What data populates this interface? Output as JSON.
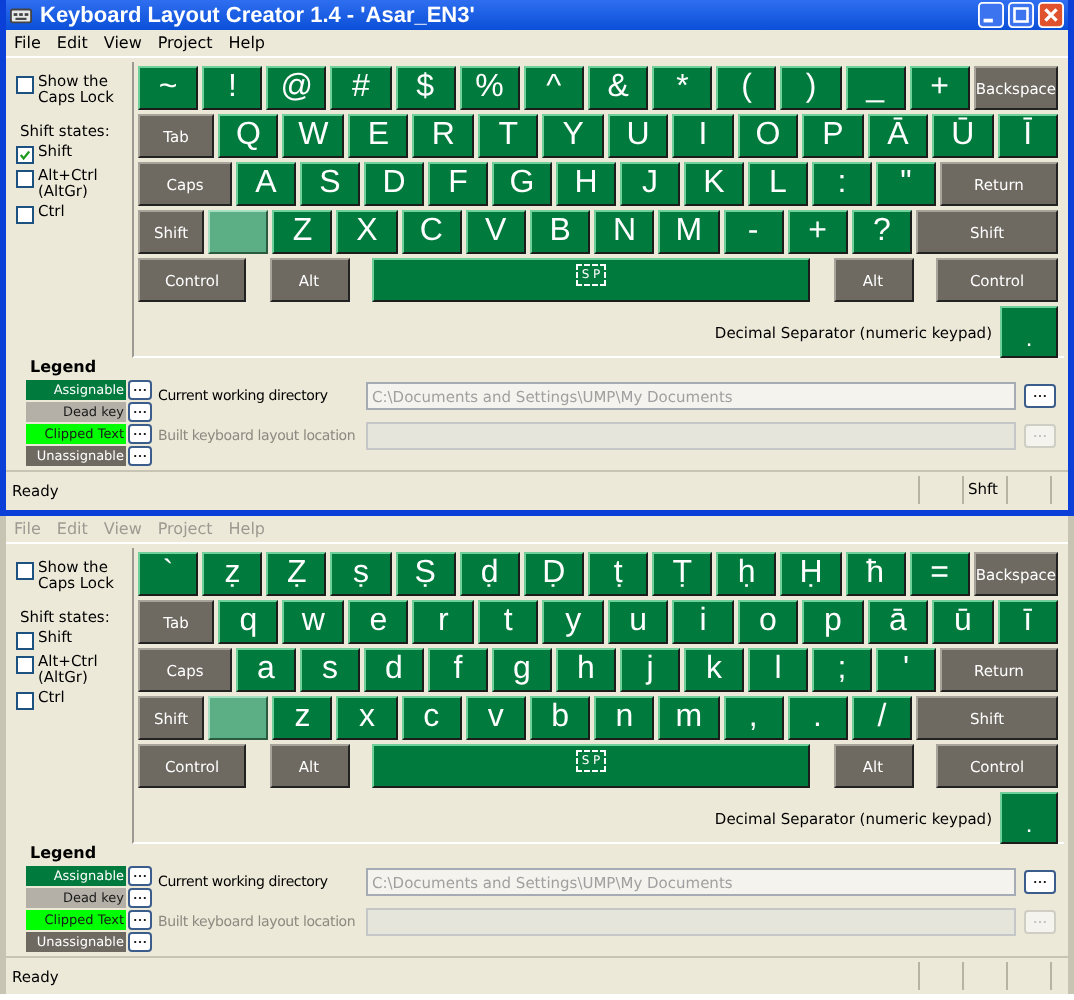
{
  "windows": [
    {
      "title": "Keyboard Layout Creator 1.4 - 'Asar_EN3'",
      "menu": [
        {
          "label": "File",
          "disabled": false
        },
        {
          "label": "Edit",
          "disabled": false
        },
        {
          "label": "View",
          "disabled": false
        },
        {
          "label": "Project",
          "disabled": false
        },
        {
          "label": "Help",
          "disabled": false
        }
      ],
      "caps_lock_option": {
        "label": "Show the Caps Lock",
        "checked": false
      },
      "shift_states": {
        "label": "Shift states:",
        "options": [
          {
            "label": "Shift",
            "checked": true
          },
          {
            "label": "Alt+Ctrl (AltGr)",
            "checked": false
          },
          {
            "label": "Ctrl",
            "checked": false
          }
        ]
      },
      "keyboard": {
        "rows": [
          [
            {
              "kind": "char",
              "label": "~"
            },
            {
              "kind": "char",
              "label": "!"
            },
            {
              "kind": "char",
              "label": "@"
            },
            {
              "kind": "char",
              "label": "#"
            },
            {
              "kind": "char",
              "label": "$"
            },
            {
              "kind": "char",
              "label": "%"
            },
            {
              "kind": "char",
              "label": "^"
            },
            {
              "kind": "char",
              "label": "&"
            },
            {
              "kind": "char",
              "label": "*"
            },
            {
              "kind": "char",
              "label": "("
            },
            {
              "kind": "char",
              "label": ")"
            },
            {
              "kind": "char",
              "label": "_"
            },
            {
              "kind": "char",
              "label": "+"
            },
            {
              "kind": "backspace",
              "label": "Backspace"
            }
          ],
          [
            {
              "kind": "tab",
              "label": "Tab"
            },
            {
              "kind": "char",
              "label": "Q"
            },
            {
              "kind": "char",
              "label": "W"
            },
            {
              "kind": "char",
              "label": "E"
            },
            {
              "kind": "char",
              "label": "R"
            },
            {
              "kind": "char",
              "label": "T"
            },
            {
              "kind": "char",
              "label": "Y"
            },
            {
              "kind": "char",
              "label": "U"
            },
            {
              "kind": "char",
              "label": "I"
            },
            {
              "kind": "char",
              "label": "O"
            },
            {
              "kind": "char",
              "label": "P"
            },
            {
              "kind": "char",
              "label": "Ā"
            },
            {
              "kind": "char",
              "label": "Ū"
            },
            {
              "kind": "char",
              "label": "Ī"
            }
          ],
          [
            {
              "kind": "caps",
              "label": "Caps"
            },
            {
              "kind": "char",
              "label": "A"
            },
            {
              "kind": "char",
              "label": "S"
            },
            {
              "kind": "char",
              "label": "D"
            },
            {
              "kind": "char",
              "label": "F"
            },
            {
              "kind": "char",
              "label": "G"
            },
            {
              "kind": "char",
              "label": "H"
            },
            {
              "kind": "char",
              "label": "J"
            },
            {
              "kind": "char",
              "label": "K"
            },
            {
              "kind": "char",
              "label": "L"
            },
            {
              "kind": "char",
              "label": ":"
            },
            {
              "kind": "char",
              "label": "\""
            },
            {
              "kind": "return",
              "label": "Return"
            }
          ],
          [
            {
              "kind": "shift_left",
              "label": "Shift"
            },
            {
              "kind": "blank"
            },
            {
              "kind": "char",
              "label": "Z"
            },
            {
              "kind": "char",
              "label": "X"
            },
            {
              "kind": "char",
              "label": "C"
            },
            {
              "kind": "char",
              "label": "V"
            },
            {
              "kind": "char",
              "label": "B"
            },
            {
              "kind": "char",
              "label": "N"
            },
            {
              "kind": "char",
              "label": "M"
            },
            {
              "kind": "char",
              "label": "-"
            },
            {
              "kind": "char",
              "label": "+"
            },
            {
              "kind": "char",
              "label": "?"
            },
            {
              "kind": "shift_right",
              "label": "Shift"
            }
          ],
          [
            {
              "kind": "control_left",
              "label": "Control"
            },
            {
              "kind": "alt",
              "label": "Alt"
            },
            {
              "kind": "space",
              "label": "S P"
            },
            {
              "kind": "alt",
              "label": "Alt"
            },
            {
              "kind": "control_right",
              "label": "Control"
            }
          ]
        ]
      },
      "decimal_separator": {
        "label": "Decimal Separator (numeric keypad)",
        "key": "."
      },
      "legend": {
        "title": "Legend",
        "items": [
          {
            "label": "Assignable",
            "color": "#007a3d"
          },
          {
            "label": "Dead key",
            "color": "#b4b0a8"
          },
          {
            "label": "Clipped Text",
            "color": "#00ff00"
          },
          {
            "label": "Unassignable",
            "color": "#6e6a62"
          }
        ]
      },
      "working_directory": {
        "label": "Current working directory",
        "value": "C:\\Documents and Settings\\UMP\\My Documents"
      },
      "build_location": {
        "label": "Built keyboard layout location",
        "disabled": true
      },
      "status_bar": {
        "text": "Ready",
        "indicators": [
          "Shft"
        ]
      }
    },
    {
      "menu": [
        {
          "label": "File",
          "disabled": true
        },
        {
          "label": "Edit",
          "disabled": true
        },
        {
          "label": "View",
          "disabled": true
        },
        {
          "label": "Project",
          "disabled": true
        },
        {
          "label": "Help",
          "disabled": true
        }
      ],
      "caps_lock_option": {
        "label": "Show the Caps Lock",
        "checked": false
      },
      "shift_states": {
        "label": "Shift states:",
        "options": [
          {
            "label": "Shift",
            "checked": false
          },
          {
            "label": "Alt+Ctrl (AltGr)",
            "checked": false
          },
          {
            "label": "Ctrl",
            "checked": false
          }
        ]
      },
      "keyboard": {
        "rows": [
          [
            {
              "kind": "char",
              "label": "`"
            },
            {
              "kind": "char",
              "label": "ẓ"
            },
            {
              "kind": "char",
              "label": "Ẓ"
            },
            {
              "kind": "char",
              "label": "ṣ"
            },
            {
              "kind": "char",
              "label": "Ṣ"
            },
            {
              "kind": "char",
              "label": "ḍ"
            },
            {
              "kind": "char",
              "label": "Ḍ"
            },
            {
              "kind": "char",
              "label": "ṭ"
            },
            {
              "kind": "char",
              "label": "Ṭ"
            },
            {
              "kind": "char",
              "label": "ḥ"
            },
            {
              "kind": "char",
              "label": "Ḥ"
            },
            {
              "kind": "char",
              "label": "ħ"
            },
            {
              "kind": "char",
              "label": "="
            },
            {
              "kind": "backspace",
              "label": "Backspace"
            }
          ],
          [
            {
              "kind": "tab",
              "label": "Tab"
            },
            {
              "kind": "char",
              "label": "q"
            },
            {
              "kind": "char",
              "label": "w"
            },
            {
              "kind": "char",
              "label": "e"
            },
            {
              "kind": "char",
              "label": "r"
            },
            {
              "kind": "char",
              "label": "t"
            },
            {
              "kind": "char",
              "label": "y"
            },
            {
              "kind": "char",
              "label": "u"
            },
            {
              "kind": "char",
              "label": "i"
            },
            {
              "kind": "char",
              "label": "o"
            },
            {
              "kind": "char",
              "label": "p"
            },
            {
              "kind": "char",
              "label": "ā"
            },
            {
              "kind": "char",
              "label": "ū"
            },
            {
              "kind": "char",
              "label": "ī"
            }
          ],
          [
            {
              "kind": "caps",
              "label": "Caps"
            },
            {
              "kind": "char",
              "label": "a"
            },
            {
              "kind": "char",
              "label": "s"
            },
            {
              "kind": "char",
              "label": "d"
            },
            {
              "kind": "char",
              "label": "f"
            },
            {
              "kind": "char",
              "label": "g"
            },
            {
              "kind": "char",
              "label": "h"
            },
            {
              "kind": "char",
              "label": "j"
            },
            {
              "kind": "char",
              "label": "k"
            },
            {
              "kind": "char",
              "label": "l"
            },
            {
              "kind": "char",
              "label": ";"
            },
            {
              "kind": "char",
              "label": "'"
            },
            {
              "kind": "return",
              "label": "Return"
            }
          ],
          [
            {
              "kind": "shift_left",
              "label": "Shift"
            },
            {
              "kind": "blank"
            },
            {
              "kind": "char",
              "label": "z"
            },
            {
              "kind": "char",
              "label": "x"
            },
            {
              "kind": "char",
              "label": "c"
            },
            {
              "kind": "char",
              "label": "v"
            },
            {
              "kind": "char",
              "label": "b"
            },
            {
              "kind": "char",
              "label": "n"
            },
            {
              "kind": "char",
              "label": "m"
            },
            {
              "kind": "char",
              "label": ","
            },
            {
              "kind": "char",
              "label": "."
            },
            {
              "kind": "char",
              "label": "/"
            },
            {
              "kind": "shift_right",
              "label": "Shift"
            }
          ],
          [
            {
              "kind": "control_left",
              "label": "Control"
            },
            {
              "kind": "alt",
              "label": "Alt"
            },
            {
              "kind": "space",
              "label": "S P"
            },
            {
              "kind": "alt",
              "label": "Alt"
            },
            {
              "kind": "control_right",
              "label": "Control"
            }
          ]
        ]
      },
      "decimal_separator": {
        "label": "Decimal Separator (numeric keypad)",
        "key": "."
      },
      "legend": {
        "title": "Legend",
        "items": [
          {
            "label": "Assignable",
            "color": "#007a3d"
          },
          {
            "label": "Dead key",
            "color": "#b4b0a8"
          },
          {
            "label": "Clipped Text",
            "color": "#00ff00"
          },
          {
            "label": "Unassignable",
            "color": "#6e6a62"
          }
        ]
      },
      "working_directory": {
        "label": "Current working directory",
        "value": "C:\\Documents and Settings\\UMP\\My Documents"
      },
      "build_location": {
        "label": "Built keyboard layout location",
        "disabled": true
      },
      "status_bar": {
        "text": "Ready"
      }
    }
  ]
}
